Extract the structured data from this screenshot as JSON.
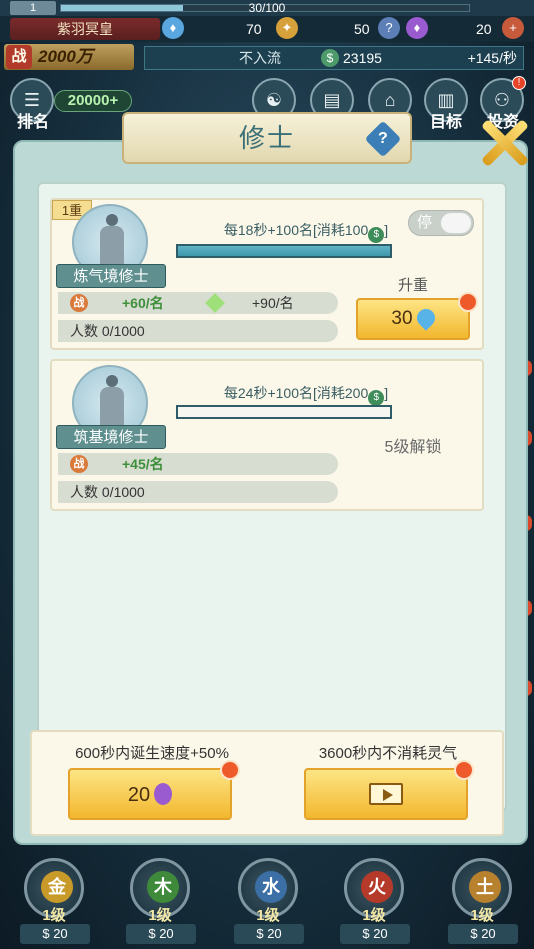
{
  "hud": {
    "level": "1",
    "exp_text": "30/100",
    "exp_progress": 0.3,
    "player_name": "紫羽冥皇",
    "resources": [
      {
        "icon": "blue-flame-icon",
        "value": "70",
        "color": "#5aa7e0"
      },
      {
        "icon": "gold-medal-icon",
        "value": "50",
        "color": "#d6a03a"
      },
      {
        "icon": "question-gem-icon",
        "value": "",
        "color": "#5b7fb6"
      },
      {
        "icon": "purple-flame-icon",
        "value": "20",
        "color": "#9a5ad0"
      }
    ],
    "power_icon": "战",
    "power_value": "2000万",
    "rank_title": "不入流",
    "spirit_stones": "23195",
    "rate": "+145/秒",
    "score_pill": "20000+",
    "nav": [
      {
        "label": "排名",
        "icon": "rank-scroll-icon"
      },
      {
        "label": "",
        "icon": "taiji-icon"
      },
      {
        "label": "",
        "icon": "book-icon"
      },
      {
        "label": "",
        "icon": "lantern-icon"
      },
      {
        "label": "目标",
        "icon": "goal-scroll-icon"
      },
      {
        "label": "投资",
        "icon": "investment-icon"
      }
    ]
  },
  "modal": {
    "title": "修士",
    "help_icon": "?",
    "cards": [
      {
        "tier_tag": "1重",
        "name": "炼气境修士",
        "rate_desc": "每18秒+100名[消耗100",
        "rate_desc_suffix": "]",
        "coin_symbol": "$",
        "progress": 1.0,
        "power_icon": "战",
        "stat_value": "+60/名",
        "stat_next": "+90/名",
        "population_label": "人数",
        "population": "0/1000",
        "toggle_label": "停",
        "upgrade_label": "升重",
        "upgrade_cost": "30"
      },
      {
        "name": "筑基境修士",
        "rate_desc": "每24秒+100名[消耗200",
        "rate_desc_suffix": "]",
        "coin_symbol": "$",
        "progress": 0.0,
        "power_icon": "战",
        "stat_value": "+45/名",
        "population_label": "人数",
        "population": "0/1000",
        "unlock_label": "5级解锁"
      }
    ],
    "boosts": [
      {
        "label": "600秒内诞生速度+50%",
        "button_value": "20"
      },
      {
        "label": "3600秒内不消耗灵气",
        "button_value": ""
      }
    ]
  },
  "elements": [
    {
      "glyph": "金",
      "level": "1级",
      "cost": "20",
      "color": "#c89a2a"
    },
    {
      "glyph": "木",
      "level": "1级",
      "cost": "20",
      "color": "#3f8a3a"
    },
    {
      "glyph": "水",
      "level": "1级",
      "cost": "20",
      "color": "#3b6fa6"
    },
    {
      "glyph": "火",
      "level": "1级",
      "cost": "20",
      "color": "#b63a2a"
    },
    {
      "glyph": "土",
      "level": "1级",
      "cost": "20",
      "color": "#b7812e"
    }
  ]
}
